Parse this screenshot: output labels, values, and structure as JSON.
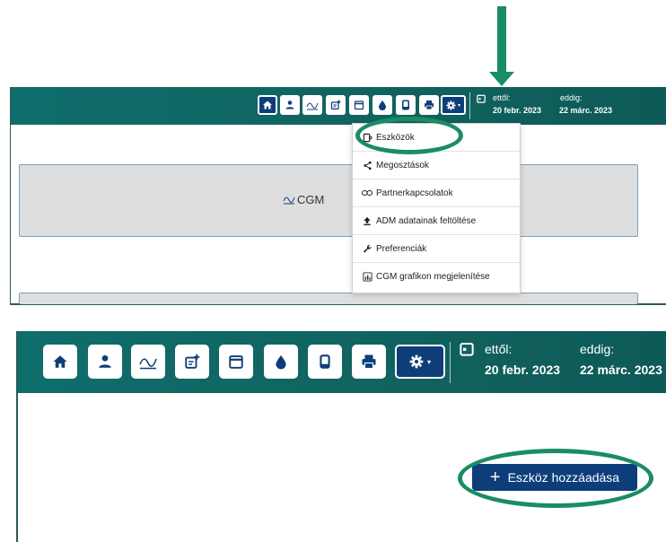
{
  "top_panel": {
    "date_from_label": "ettől:",
    "date_to_label": "eddig:",
    "date_from_value": "20 febr. 2023",
    "date_to_value": "22 márc. 2023",
    "cgm_card_label": "CGM",
    "dropdown_items": [
      {
        "label": "Eszközök",
        "icon": "device-icon"
      },
      {
        "label": "Megosztások",
        "icon": "share-icon"
      },
      {
        "label": "Partnerkapcsolatok",
        "icon": "link-icon"
      },
      {
        "label": "ADM adatainak feltöltése",
        "icon": "upload-icon"
      },
      {
        "label": "Preferenciák",
        "icon": "wrench-icon"
      },
      {
        "label": "CGM grafikon megjelenítése",
        "icon": "chart-icon"
      }
    ]
  },
  "bottom_panel": {
    "date_from_label": "ettől:",
    "date_to_label": "eddig:",
    "date_from_value": "20 febr. 2023",
    "date_to_value": "22 márc. 2023",
    "add_device_label": "Eszköz hozzáadása",
    "add_device_icon": "plus-icon"
  },
  "toolbar_icons": [
    "home-icon",
    "person-icon",
    "cgm-icon",
    "note-add-icon",
    "calendar-icon",
    "drop-icon",
    "device-icon",
    "print-icon",
    "gear-icon"
  ],
  "colors": {
    "header": "#0f6e6c",
    "active_button": "#0d3e7a",
    "annotation_green": "#1a8c66",
    "card_gray": "#dedede"
  }
}
